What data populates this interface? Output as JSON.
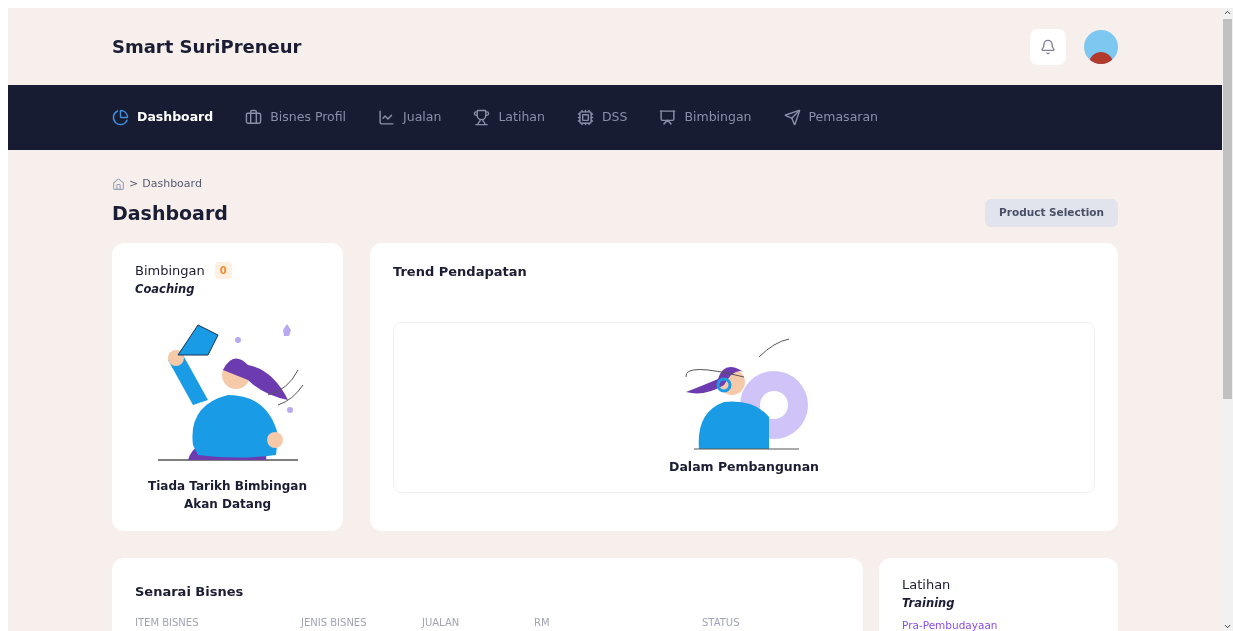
{
  "app": {
    "title": "Smart SuriPreneur"
  },
  "nav": [
    {
      "label": "Dashboard",
      "selected": true
    },
    {
      "label": "Bisnes Profil",
      "selected": false
    },
    {
      "label": "Jualan",
      "selected": false
    },
    {
      "label": "Latihan",
      "selected": false
    },
    {
      "label": "DSS",
      "selected": false
    },
    {
      "label": "Bimbingan",
      "selected": false
    },
    {
      "label": "Pemasaran",
      "selected": false
    }
  ],
  "breadcrumb": {
    "separator": ">",
    "current": "Dashboard"
  },
  "page": {
    "title": "Dashboard",
    "action": "Product Selection"
  },
  "coaching_card": {
    "title": "Bimbingan",
    "count": "0",
    "subtitle": "Coaching",
    "message": "Tiada Tarikh Bimbingan Akan Datang"
  },
  "trend_card": {
    "title": "Trend Pendapatan",
    "message": "Dalam Pembangunan"
  },
  "business_list": {
    "title": "Senarai Bisnes",
    "columns": [
      "ITEM BISNES",
      "JENIS BISNES",
      "JUALAN",
      "RM",
      "STATUS"
    ]
  },
  "training_card": {
    "title": "Latihan",
    "subtitle": "Training",
    "items": [
      "Pra-Pembudayaan"
    ]
  }
}
